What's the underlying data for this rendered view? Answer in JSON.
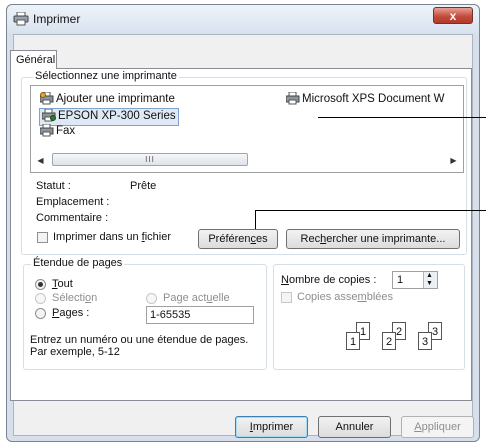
{
  "window": {
    "title": "Imprimer",
    "close_glyph": "x"
  },
  "tabs": {
    "general": "Général"
  },
  "printer_group": {
    "legend": "Sélectionnez une imprimante",
    "printers": {
      "add": "Ajouter une imprimante",
      "xps": "Microsoft XPS Document W",
      "epson": "EPSON XP-300 Series",
      "fax": "Fax"
    },
    "scrollbar_thumb": "III",
    "status_label": "Statut :",
    "status_value": "Prête",
    "location_label": "Emplacement :",
    "comment_label": "Commentaire :",
    "print_to_file": {
      "pre": "Imprimer dans un ",
      "accel": "f",
      "post": "ichier"
    },
    "preferences": {
      "pre": "Préféren",
      "accel": "c",
      "post": "es"
    },
    "find_printer": {
      "pre": "Rec",
      "accel": "h",
      "post": "ercher une imprimante..."
    }
  },
  "range_group": {
    "legend": "Étendue de pages",
    "all": {
      "accel": "T",
      "post": "out"
    },
    "selection": {
      "pre": "Sélecti",
      "accel": "o",
      "post": "n"
    },
    "current_page": {
      "pre": "Page act",
      "accel": "u",
      "post": "elle"
    },
    "pages": {
      "accel": "P",
      "post": "ages :"
    },
    "pages_value": "1-65535",
    "help_line1": "Entrez un numéro ou une étendue de pages.",
    "help_line2": "Par exemple, 5-12"
  },
  "copies_group": {
    "copies_label": {
      "accel": "N",
      "post": "ombre de copies :"
    },
    "copies_value": "1",
    "collate": {
      "pre": "Copies asse",
      "accel": "m",
      "post": "blées"
    },
    "collate_pages": [
      "1",
      "1",
      "2",
      "2",
      "3",
      "3"
    ]
  },
  "footer": {
    "print": {
      "accel": "I",
      "post": "mprimer"
    },
    "cancel": "Annuler",
    "apply": {
      "accel": "A",
      "post": "ppliquer"
    }
  }
}
